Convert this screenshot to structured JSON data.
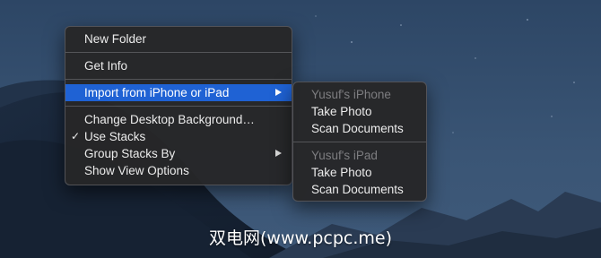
{
  "main_menu": {
    "new_folder": "New Folder",
    "get_info": "Get Info",
    "import_from_device": "Import from iPhone or iPad",
    "change_desktop_background": "Change Desktop Background…",
    "use_stacks": "Use Stacks",
    "use_stacks_checked": true,
    "check_glyph": "✓",
    "group_stacks_by": "Group Stacks By",
    "show_view_options": "Show View Options"
  },
  "submenu": {
    "iphone_header": "Yusuf's iPhone",
    "iphone_take_photo": "Take Photo",
    "iphone_scan_documents": "Scan Documents",
    "ipad_header": "Yusuf's iPad",
    "ipad_take_photo": "Take Photo",
    "ipad_scan_documents": "Scan Documents"
  },
  "watermark": "双电网(www.pcpc.me)",
  "colors": {
    "highlight": "#1f62d4",
    "menu_background": "#262628",
    "disabled_text": "#7d7d80"
  }
}
